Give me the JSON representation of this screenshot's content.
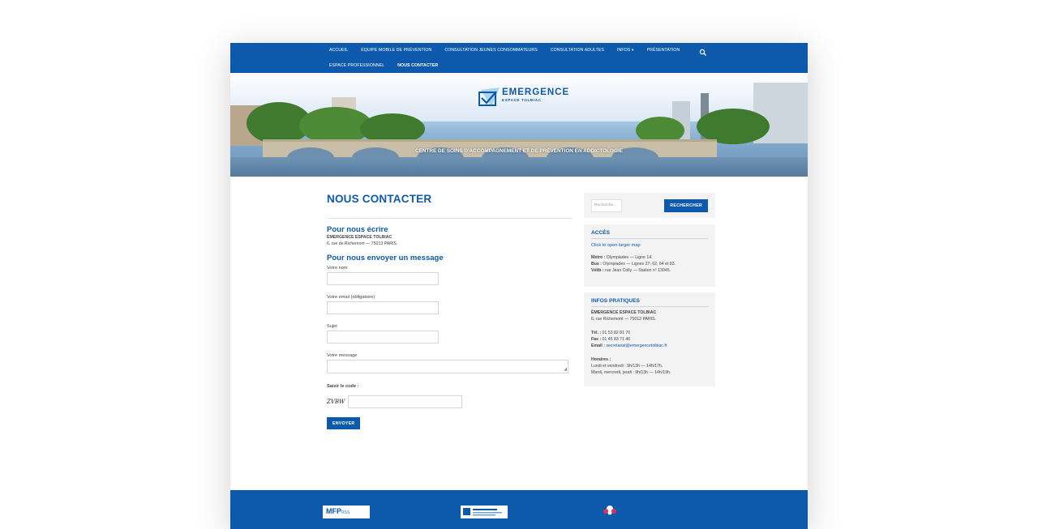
{
  "nav": {
    "row1": [
      "ACCUEIL",
      "ÉQUIPE MOBILE DE PRÉVENTION",
      "CONSULTATION JEUNES CONSOMMATEURS",
      "CONSULTATION ADULTES",
      "INFOS",
      "PRÉSENTATION"
    ],
    "infos_caret": "▾",
    "row2": [
      "ESPACE PROFESSIONNEL",
      "NOUS CONTACTER"
    ],
    "search_icon": "search-icon"
  },
  "hero": {
    "logo_title": "EMERGENCE",
    "logo_sub": "ESPACE TOLBIAC",
    "tagline": "CENTRE DE SOINS D'ACCOMPAGNEMENT ET DE PRÉVENTION EN ADDICTOLOGIE"
  },
  "main": {
    "title": "NOUS CONTACTER",
    "write_heading": "Pour nous écrire",
    "org_name": "ÉMERGENCE ESPACE TOLBIAC",
    "address": "6, rue de Richemont — 75013 PARIS.",
    "message_heading": "Pour nous envoyer un message",
    "form": {
      "name_label": "Votre nom",
      "email_label": "Votre email (obligatoire)",
      "subject_label": "Sujet",
      "message_label": "Votre message",
      "code_label": "Saisir le code :",
      "captcha": "ZVBW",
      "submit": "ENVOYER"
    }
  },
  "sidebar": {
    "search_placeholder": "Recherche...",
    "search_button": "RECHERCHER",
    "access_title": "ACCÈS",
    "map_link": "Click to open larger map",
    "metro_label": "Métro :",
    "metro_value": " Olympiades — Ligne 14.",
    "bus_label": "Bus :",
    "bus_value": " Olympiades — Lignes 27, 62, 64 et 83.",
    "velib_label": "Vélib :",
    "velib_value": " rue Jean Colly — Station n° 13045.",
    "infos_title": "INFOS PRATIQUES",
    "org_name": "ÉMERGENCE ESPACE TOLBIAC",
    "address": "6, rue Richemont — 75013 PARIS.",
    "tel_label": "Tél. :",
    "tel_value": " 01 53 82 81 70",
    "fax_label": "Fax :",
    "fax_value": " 01 45 83 71 40",
    "email_label": "Email :",
    "email_value": " secretariat@emergencetolbiac.fr",
    "hours_label": "Horaires :",
    "hours_1": "Lundi et vendredi : 9h/13h — 14h/17h.",
    "hours_2": "Mardi, mercredi, jeudi : 9h/13h — 14h/19h."
  },
  "footer": {
    "logo1": "MFP",
    "logo1_sub": "RSS"
  },
  "colors": {
    "brand": "#0d5aad",
    "widget_bg": "#f3f3f3"
  }
}
